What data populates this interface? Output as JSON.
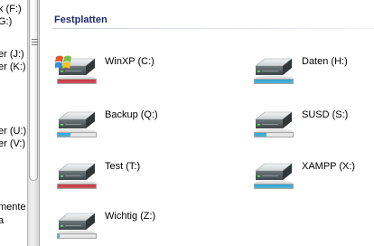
{
  "nav": {
    "items": [
      {
        "text": "k (F:)"
      },
      {
        "text": "G:)"
      },
      {
        "text": "er (J:)"
      },
      {
        "text": "er (K:)"
      },
      {
        "text": "er (U:)"
      },
      {
        "text": "er (V:)"
      },
      {
        "text": "mente"
      },
      {
        "text": "a"
      }
    ]
  },
  "section": {
    "title": "Festplatten"
  },
  "colors": {
    "bar_full": "#c8353f",
    "bar_ok": "#2fa6d3"
  },
  "drives": [
    {
      "label": "WinXP (C:)",
      "usage_fraction": 1.0,
      "status": "full",
      "logo": true
    },
    {
      "label": "Backup (Q:)",
      "usage_fraction": 0.33,
      "status": "ok",
      "logo": false
    },
    {
      "label": "Test (T:)",
      "usage_fraction": 1.0,
      "status": "full",
      "logo": false
    },
    {
      "label": "Wichtig (Z:)",
      "usage_fraction": 0.04,
      "status": "ok",
      "logo": false
    },
    {
      "label": "Daten (H:)",
      "usage_fraction": 1.0,
      "status": "ok",
      "logo": false
    },
    {
      "label": "SUSD (S:)",
      "usage_fraction": 0.3,
      "status": "ok",
      "logo": false
    },
    {
      "label": "XAMPP (X:)",
      "usage_fraction": 1.0,
      "status": "ok",
      "logo": false
    }
  ]
}
